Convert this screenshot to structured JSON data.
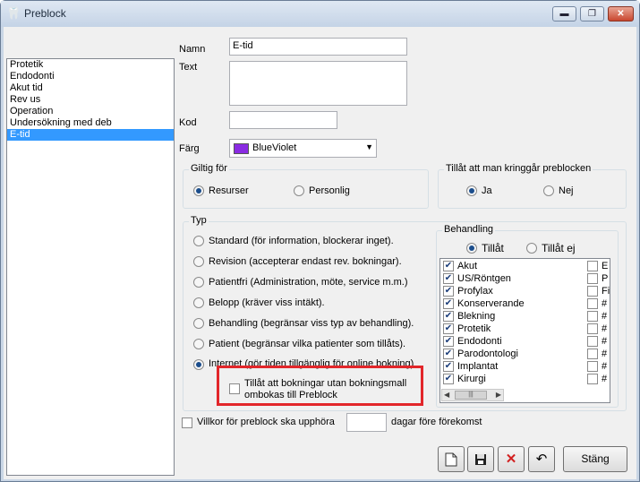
{
  "window": {
    "title": "Preblock",
    "minimize": "▬",
    "maximize": "❐",
    "close": "✕"
  },
  "list": {
    "items": [
      {
        "label": "Protetik",
        "selected": false
      },
      {
        "label": "Endodonti",
        "selected": false
      },
      {
        "label": "Akut tid",
        "selected": false
      },
      {
        "label": "Rev us",
        "selected": false
      },
      {
        "label": "Operation",
        "selected": false
      },
      {
        "label": "Undersökning med deb",
        "selected": false
      },
      {
        "label": "E-tid",
        "selected": true
      }
    ]
  },
  "form": {
    "name_label": "Namn",
    "name_value": "E-tid",
    "text_label": "Text",
    "text_value": "",
    "code_label": "Kod",
    "code_value": "",
    "color_label": "Färg",
    "color_value": "BlueViolet",
    "color_hex": "#8a2be2"
  },
  "valid_for": {
    "title": "Giltig för",
    "options": [
      {
        "label": "Resurser",
        "checked": true
      },
      {
        "label": "Personlig",
        "checked": false
      }
    ]
  },
  "allow_bypass": {
    "title": "Tillåt att man kringgår preblocken",
    "options": [
      {
        "label": "Ja",
        "checked": true
      },
      {
        "label": "Nej",
        "checked": false
      }
    ]
  },
  "type": {
    "title": "Typ",
    "options": [
      {
        "label": "Standard (för information, blockerar inget).",
        "checked": false
      },
      {
        "label": "Revision (accepterar endast rev. bokningar).",
        "checked": false
      },
      {
        "label": "Patientfri (Administration, möte, service m.m.)",
        "checked": false
      },
      {
        "label": "Belopp (kräver viss intäkt).",
        "checked": false
      },
      {
        "label": "Behandling (begränsar viss typ av behandling).",
        "checked": false
      },
      {
        "label": "Patient (begränsar vilka patienter som tillåts).",
        "checked": false
      },
      {
        "label": "Internet (gör tiden tillgänglig för online bokning)",
        "checked": true
      }
    ],
    "allow_without_template_line1": "Tillåt att bokningar utan bokningsmall",
    "allow_without_template_line2": "ombokas till Preblock"
  },
  "treatment": {
    "title": "Behandling",
    "allow_label": "Tillåt",
    "disallow_label": "Tillåt ej",
    "items_col1": [
      "Akut",
      "US/Röntgen",
      "Profylax",
      "Konserverande",
      "Blekning",
      "Protetik",
      "Endodonti",
      "Parodontologi",
      "Implantat",
      "Kirurgi"
    ],
    "items_col2": [
      "E",
      "P",
      "Fi",
      "#",
      "#",
      "#",
      "#",
      "#",
      "#",
      "#"
    ],
    "scroll_thumb": "|||"
  },
  "terms": {
    "label": "Villkor för preblock ska upphöra",
    "days_value": "",
    "suffix": "dagar före förekomst"
  },
  "toolbar": {
    "new_icon": "new-document-icon",
    "save_icon": "save-icon",
    "delete_icon": "delete-icon",
    "undo_icon": "undo-icon",
    "close_label": "Stäng"
  }
}
